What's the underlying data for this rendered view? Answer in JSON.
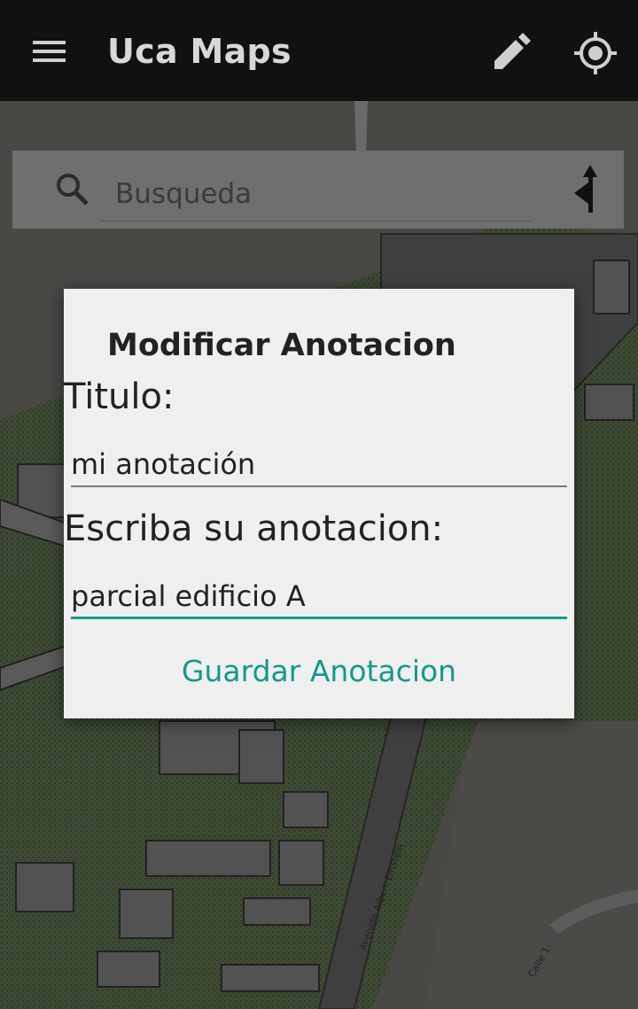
{
  "appbar": {
    "title": "Uca Maps",
    "menu_icon": "hamburger-menu-icon",
    "edit_icon": "pencil-icon",
    "location_icon": "gps-target-icon"
  },
  "search": {
    "placeholder": "Busqueda",
    "search_icon": "search-icon",
    "directions_icon": "directions-arrow-icon"
  },
  "map": {
    "street_labels": [
      "Avenida Albert Einstein",
      "Calle 1"
    ]
  },
  "dialog": {
    "title": "Modificar Anotacion",
    "title_label": "Titulo:",
    "title_value": "mi anotación",
    "note_label": "Escriba su anotacion:",
    "note_value": "parcial edificio A",
    "save_label": "Guardar Anotacion"
  },
  "colors": {
    "accent": "#139a8c",
    "appbar": "#111111",
    "dialog_bg": "#efefef"
  }
}
